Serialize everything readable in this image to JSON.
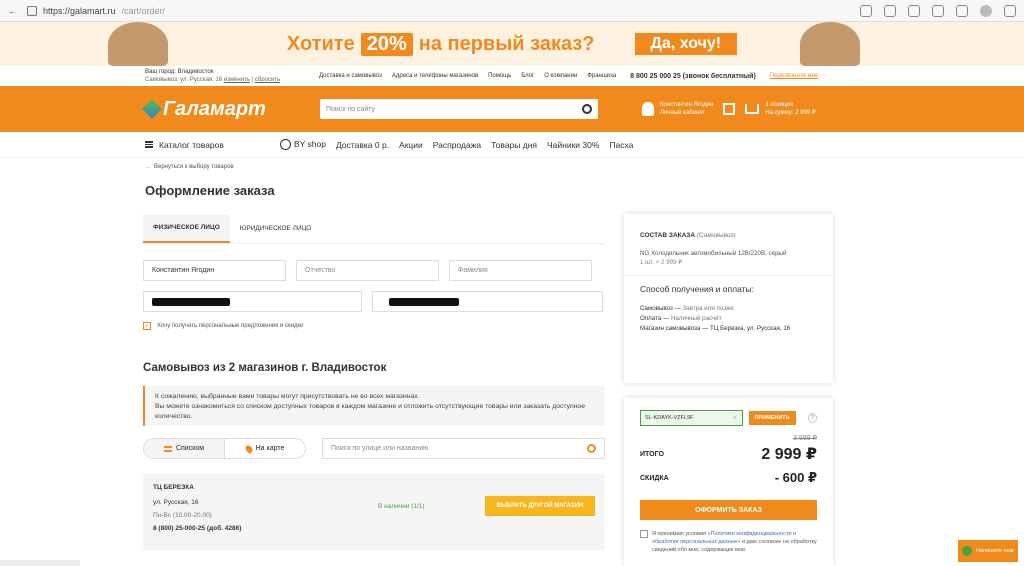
{
  "browser": {
    "url_host": "https://galamart.ru",
    "url_path": "/cart/order/"
  },
  "banner": {
    "text_before": "Хотите",
    "percent": "20%",
    "text_after": "на первый заказ?",
    "cta": "Да, хочу!"
  },
  "topinfo": {
    "city": "Ваш город: Владивосток",
    "pickup": "Самовывоз: ул. Русская, 16",
    "change": "изменить",
    "reset": "сбросить",
    "links": [
      "Доставка и самовывоз",
      "Адреса и телефоны магазинов",
      "Помощь",
      "Блог",
      "О компании",
      "Франшиза"
    ],
    "phone": "8 800 25 000 25 (звонок бесплатный)",
    "callback": "Перезвоните мне"
  },
  "header": {
    "logo": "Галамарт",
    "search_placeholder": "Поиск по сайту",
    "user_name": "Константин Ягодин",
    "user_cabinet": "Личный кабинет",
    "cart_count": "1 позиция",
    "cart_sum": "На сумму: 2 999 ₽"
  },
  "nav": {
    "catalog": "Каталог товаров",
    "items": [
      "BY shop",
      "Доставка 0 р.",
      "Акции",
      "Распродажа",
      "Товары дня",
      "Чайники 30%",
      "Пасха"
    ]
  },
  "page": {
    "back": "Вернуться к выбору товаров",
    "title": "Оформление заказа"
  },
  "form": {
    "tabs": [
      "ФИЗИЧЕСКОЕ ЛИЦО",
      "ЮРИДИЧЕСКОЕ ЛИЦО"
    ],
    "first_name": "Константин Ягодин",
    "middle_placeholder": "Отчество",
    "last_placeholder": "Фамилия",
    "subscribe": "Хочу получать персональные предложения и скидки"
  },
  "pickup": {
    "title": "Самовывоз из 2 магазинов г. Владивосток",
    "notice_1": "К сожалению, выбранные вами товары могут присутствовать не во всех магазинах.",
    "notice_2": "Вы можете ознакомиться со списком доступных товаров в каждом магазине и отложить отсутствующие товары или заказать доступное количество.",
    "view_list": "Списком",
    "view_map": "На карте",
    "search_placeholder": "Поиск по улице или названию"
  },
  "store": {
    "name": "ТЦ БЕРЕЗКА",
    "address": "ул. Русская, 16",
    "hours": "Пн-Вс (10.00-20.00)",
    "phone": "8 (800) 25-000-25 (доб. 4286)",
    "availability": "В наличии (1/1)",
    "choose": "ВЫБРАТЬ ДРУГОЙ МАГАЗИН"
  },
  "summary": {
    "heading": "СОСТАВ ЗАКАЗА",
    "heading_sub": "(Самовывоз)",
    "product": "NG Холодильник автомобильный 12В/220В, серый",
    "qty": "1 шт. × 2 999 ₽",
    "method_heading": "Способ получения и оплаты:",
    "m1_label": "Самовывоз —",
    "m1_value": "Завтра или позже",
    "m2_label": "Оплата —",
    "m2_value": "Наличный расчёт",
    "m3": "Магазин самовывоза — ТЦ Березка, ул. Русская, 16"
  },
  "totals": {
    "promo_code": "SL-KDAYK-VZFL9F",
    "promo_btn": "ПРИМЕНИТЬ",
    "help": "?",
    "old_price": "3 599 ₽",
    "total_label": "ИТОГО",
    "total_value": "2 999 ₽",
    "discount_label": "СКИДКА",
    "discount_value": "- 600 ₽",
    "order_btn": "ОФОРМИТЬ ЗАКАЗ",
    "consent_1": "Я принимаю условия",
    "consent_link": "«Политики конфиденциальности и обработки персональных данных»",
    "consent_2": "и даю согласие на обработку сведений обо мне, содержащих мои"
  },
  "callme": {
    "label": "Напишите нам"
  },
  "colors": {
    "accent": "#f18a1d",
    "ok": "#48a23f",
    "yellow": "#f7b61d"
  }
}
